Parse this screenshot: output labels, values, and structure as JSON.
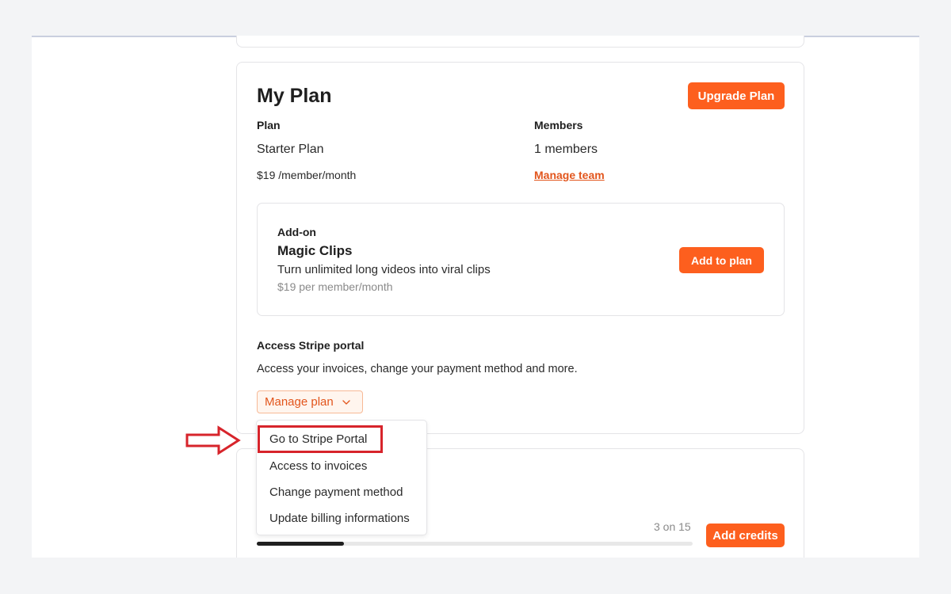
{
  "plan_card": {
    "title": "My Plan",
    "upgrade_label": "Upgrade Plan",
    "plan_label": "Plan",
    "plan_name": "Starter Plan",
    "plan_price": "$19 /member/month",
    "members_label": "Members",
    "members_value": "1 members",
    "manage_team_label": "Manage team"
  },
  "addon": {
    "kicker": "Add-on",
    "name": "Magic Clips",
    "description": "Turn unlimited long videos into viral clips",
    "price": "$19 per member/month",
    "button_label": "Add to plan"
  },
  "stripe": {
    "heading": "Access Stripe portal",
    "description": "Access your invoices, change your payment method and more.",
    "manage_label": "Manage plan",
    "menu": [
      "Go to Stripe Portal",
      "Access to invoices",
      "Change payment method",
      "Update billing informations"
    ]
  },
  "credits": {
    "count_text": "3 on 15",
    "used": 3,
    "total": 15,
    "button_label": "Add credits"
  },
  "colors": {
    "accent": "#fd5f1e",
    "annotation": "#d7242b"
  }
}
